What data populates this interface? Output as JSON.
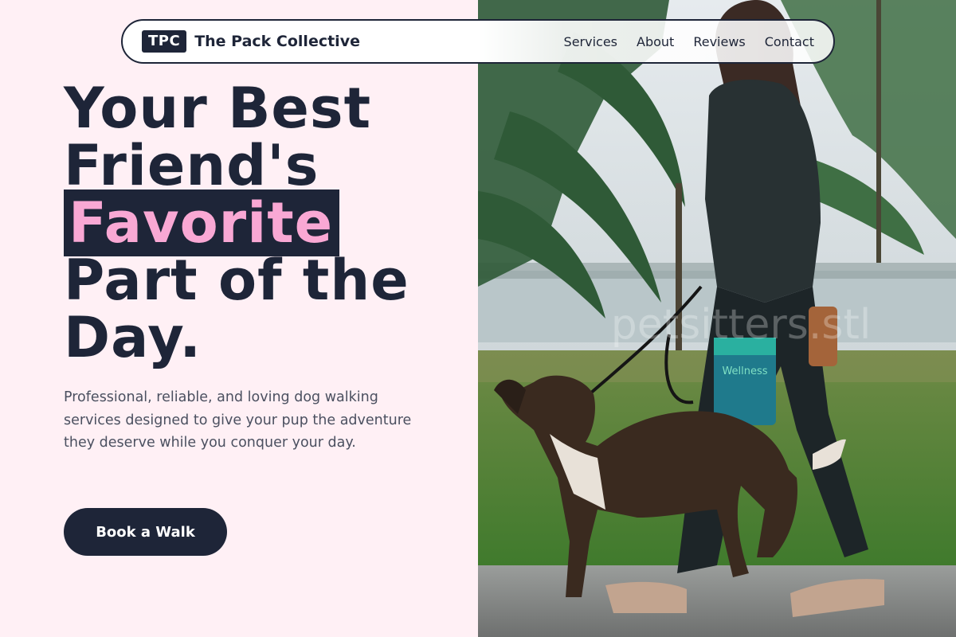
{
  "brand": {
    "logo_text": "TPC",
    "name": "The Pack Collective"
  },
  "nav": {
    "links": [
      {
        "label": "Services"
      },
      {
        "label": "About"
      },
      {
        "label": "Reviews"
      },
      {
        "label": "Contact"
      }
    ]
  },
  "hero": {
    "title_line1": "Your Best",
    "title_line2": "Friend's",
    "title_highlight": "Favorite",
    "title_line4": "Part of the",
    "title_line5": "Day.",
    "subtitle": "Professional, reliable, and loving dog walking services designed to give your pup the adventure they deserve while you conquer your day.",
    "cta_label": "Book a Walk"
  },
  "photo": {
    "watermark": "petsitters.stl",
    "bag_label": "Wellness"
  },
  "colors": {
    "navy": "#1e2538",
    "pink_bg": "#fff0f5",
    "pink_accent": "#f9a8d4"
  }
}
